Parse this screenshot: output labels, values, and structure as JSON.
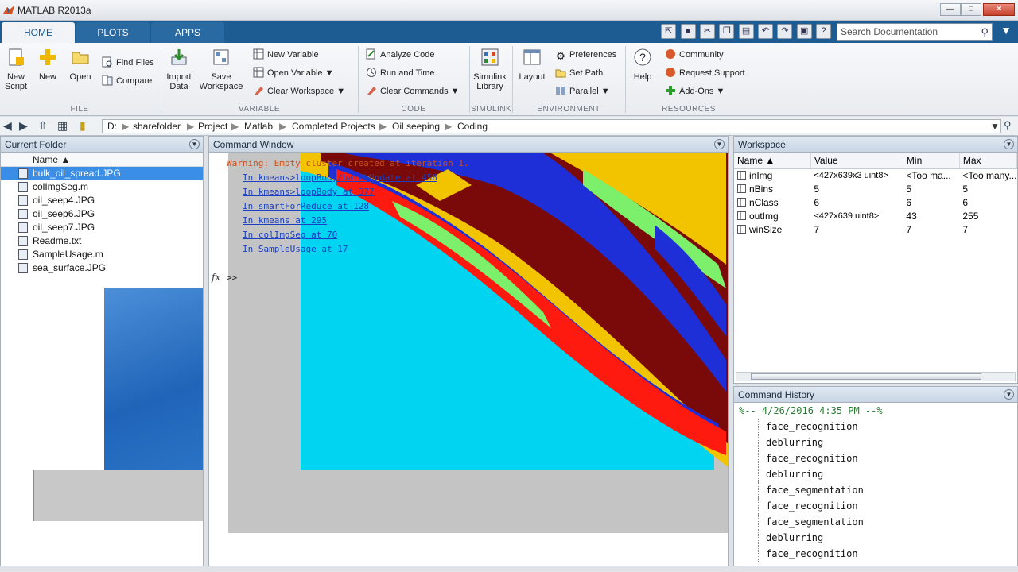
{
  "window": {
    "title": "MATLAB R2013a"
  },
  "tabs": [
    "HOME",
    "PLOTS",
    "APPS"
  ],
  "search": {
    "placeholder": "Search Documentation"
  },
  "ribbon": {
    "file": {
      "new_script": "New Script",
      "new": "New",
      "open": "Open",
      "find_files": "Find Files",
      "compare": "Compare",
      "label": "FILE"
    },
    "variable": {
      "import_data": "Import Data",
      "save_workspace": "Save Workspace",
      "new_variable": "New Variable",
      "open_variable": "Open Variable",
      "clear_workspace": "Clear Workspace",
      "label": "VARIABLE"
    },
    "code": {
      "analyze_code": "Analyze Code",
      "run_and_time": "Run and Time",
      "clear_commands": "Clear Commands",
      "label": "CODE"
    },
    "simulink": {
      "library": "Simulink Library",
      "label": "SIMULINK"
    },
    "environment": {
      "layout": "Layout",
      "preferences": "Preferences",
      "set_path": "Set Path",
      "parallel": "Parallel",
      "label": "ENVIRONMENT"
    },
    "resources": {
      "help": "Help",
      "community": "Community",
      "request_support": "Request Support",
      "add_ons": "Add-Ons",
      "label": "RESOURCES"
    }
  },
  "path": [
    "D:",
    "sharefolder",
    "Project",
    "Matlab",
    "Completed Projects",
    "Oil seeping",
    "Coding"
  ],
  "current_folder": {
    "title": "Current Folder",
    "column": "Name",
    "files": [
      "bulk_oil_spread.JPG",
      "colImgSeg.m",
      "oil_seep4.JPG",
      "oil_seep6.JPG",
      "oil_seep7.JPG",
      "Readme.txt",
      "SampleUsage.m",
      "sea_surface.JPG"
    ]
  },
  "command_window": {
    "title": "Command Window",
    "warning": "Warning: Empty cluster created at iteration 1.",
    "trace": [
      "In kmeans>loopBody/batchUpdate at 458",
      "In kmeans>loopBody at 377",
      "In smartForReduce at 128",
      "In kmeans at 295",
      "In colImgSeg at 70",
      "In SampleUsage at 17"
    ],
    "prompt": ">>"
  },
  "workspace": {
    "title": "Workspace",
    "columns": [
      "Name",
      "Value",
      "Min",
      "Max"
    ],
    "rows": [
      {
        "name": "inImg",
        "value": "<427x639x3 uint8>",
        "min": "<Too ma...",
        "max": "<Too many..."
      },
      {
        "name": "nBins",
        "value": "5",
        "min": "5",
        "max": "5"
      },
      {
        "name": "nClass",
        "value": "6",
        "min": "6",
        "max": "6"
      },
      {
        "name": "outImg",
        "value": "<427x639 uint8>",
        "min": "43",
        "max": "255"
      },
      {
        "name": "winSize",
        "value": "7",
        "min": "7",
        "max": "7"
      }
    ]
  },
  "command_history": {
    "title": "Command History",
    "header": "%-- 4/26/2016 4:35 PM --%",
    "items": [
      "face_recognition",
      "deblurring",
      "face_recognition",
      "deblurring",
      "face_segmentation",
      "face_recognition",
      "face_segmentation",
      "deblurring",
      "face_recognition"
    ]
  },
  "overlay_image_colors": {
    "sea": "#00d4f0",
    "sand": "#f2c400",
    "maroon": "#7a0a0a",
    "blue": "#1f2fd8",
    "red": "#ff1a10",
    "green": "#7cf06a"
  }
}
